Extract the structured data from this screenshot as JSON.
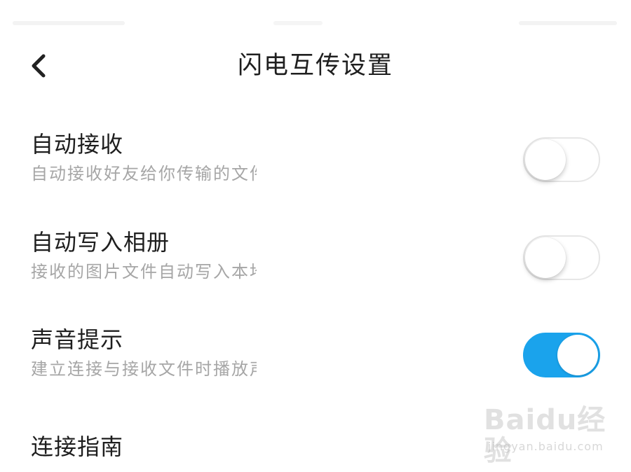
{
  "header": {
    "title": "闪电互传设置",
    "back_icon": "chevron-left-icon"
  },
  "settings": [
    {
      "title": "自动接收",
      "description": "自动接收好友给你传输的文件",
      "enabled": false
    },
    {
      "title": "自动写入相册",
      "description": "接收的图片文件自动写入本地",
      "enabled": false
    },
    {
      "title": "声音提示",
      "description": "建立连接与接收文件时播放声音",
      "enabled": true
    }
  ],
  "guide": {
    "title": "连接指南"
  },
  "watermark": {
    "logo": "Baidu经验",
    "url": "jingyan.baidu.com"
  },
  "colors": {
    "accent": "#1aa3ec",
    "title_text": "#1e1e1e",
    "secondary_text": "#a6a6a6",
    "toggle_off_border": "#e6e6e6"
  }
}
